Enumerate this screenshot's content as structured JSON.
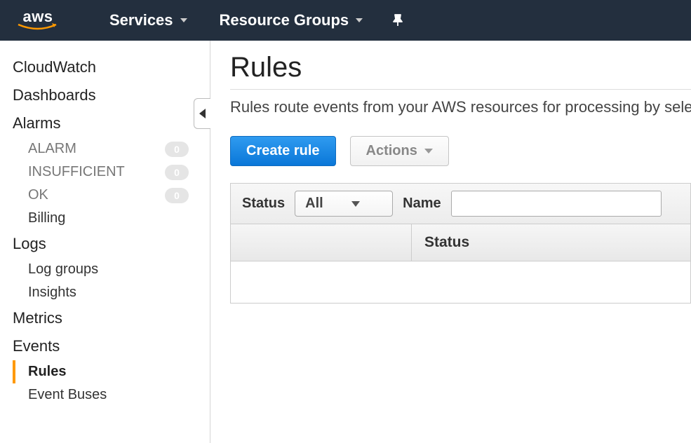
{
  "nav": {
    "logo": "aws",
    "items": [
      "Services",
      "Resource Groups"
    ]
  },
  "sidebar": {
    "cloudwatch": "CloudWatch",
    "dashboards": "Dashboards",
    "alarms": {
      "label": "Alarms",
      "alarm": {
        "label": "ALARM",
        "count": "0"
      },
      "insufficient": {
        "label": "INSUFFICIENT",
        "count": "0"
      },
      "ok": {
        "label": "OK",
        "count": "0"
      },
      "billing": "Billing"
    },
    "logs": {
      "label": "Logs",
      "groups": "Log groups",
      "insights": "Insights"
    },
    "metrics": "Metrics",
    "events": {
      "label": "Events",
      "rules": "Rules",
      "buses": "Event Buses"
    }
  },
  "main": {
    "title": "Rules",
    "description": "Rules route events from your AWS resources for processing by select",
    "create_label": "Create rule",
    "actions_label": "Actions",
    "filter": {
      "status_label": "Status",
      "status_value": "All",
      "name_label": "Name",
      "name_value": ""
    },
    "table": {
      "col_name": "",
      "col_status": "Status"
    }
  }
}
